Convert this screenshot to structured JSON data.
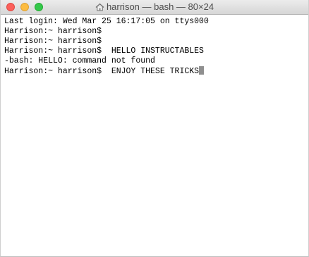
{
  "window": {
    "title": "harrison — bash — 80×24",
    "controls": {
      "close_color": "#fc605b",
      "minimize_color": "#fdbc40",
      "zoom_color": "#34c84a"
    },
    "title_icon": "home-icon"
  },
  "terminal": {
    "lines": [
      "Last login: Wed Mar 25 16:17:05 on ttys000",
      "Harrison:~ harrison$",
      "Harrison:~ harrison$",
      "Harrison:~ harrison$  HELLO INSTRUCTABLES",
      "-bash: HELLO: command not found",
      "Harrison:~ harrison$  ENJOY THESE TRICKS"
    ],
    "cursor_color": "#8f8f8f"
  }
}
